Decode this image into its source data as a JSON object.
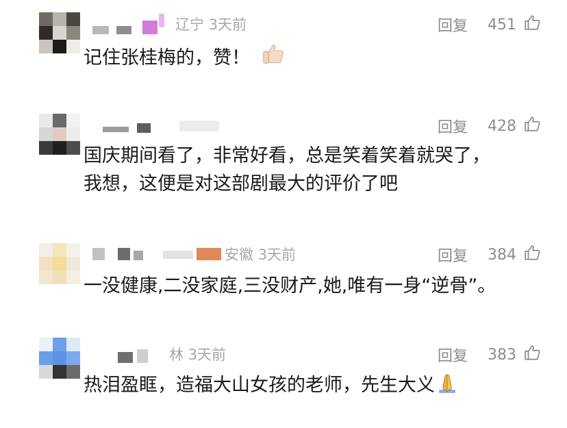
{
  "comments": [
    {
      "location": "辽宁",
      "time": "3天前",
      "reply_label": "回复",
      "likes": "451",
      "text_lines": [
        "记住张桂梅的，赞！"
      ],
      "emoji": "thumbs-up"
    },
    {
      "location": "",
      "time": "",
      "reply_label": "回复",
      "likes": "428",
      "text_lines": [
        "国庆期间看了，非常好看，总是笑着笑着就哭了，",
        "我想，这便是对这部剧最大的评价了吧"
      ]
    },
    {
      "location": "安徽",
      "time": "3天前",
      "reply_label": "回复",
      "likes": "384",
      "text_lines": [
        "一没健康,二没家庭,三没财产,她,唯有一身“逆骨”。"
      ]
    },
    {
      "location": "林",
      "time": "3天前",
      "reply_label": "回复",
      "likes": "383",
      "text_lines": [
        "热泪盈眶，造福大山女孩的老师，先生大义"
      ],
      "emoji": "folded-hands"
    }
  ],
  "icons": {
    "like": "thumbs-up-outline-icon"
  },
  "colors": {
    "meta": "#a7a7a7",
    "action": "#8c8c8c",
    "text": "#1a1a1a"
  }
}
